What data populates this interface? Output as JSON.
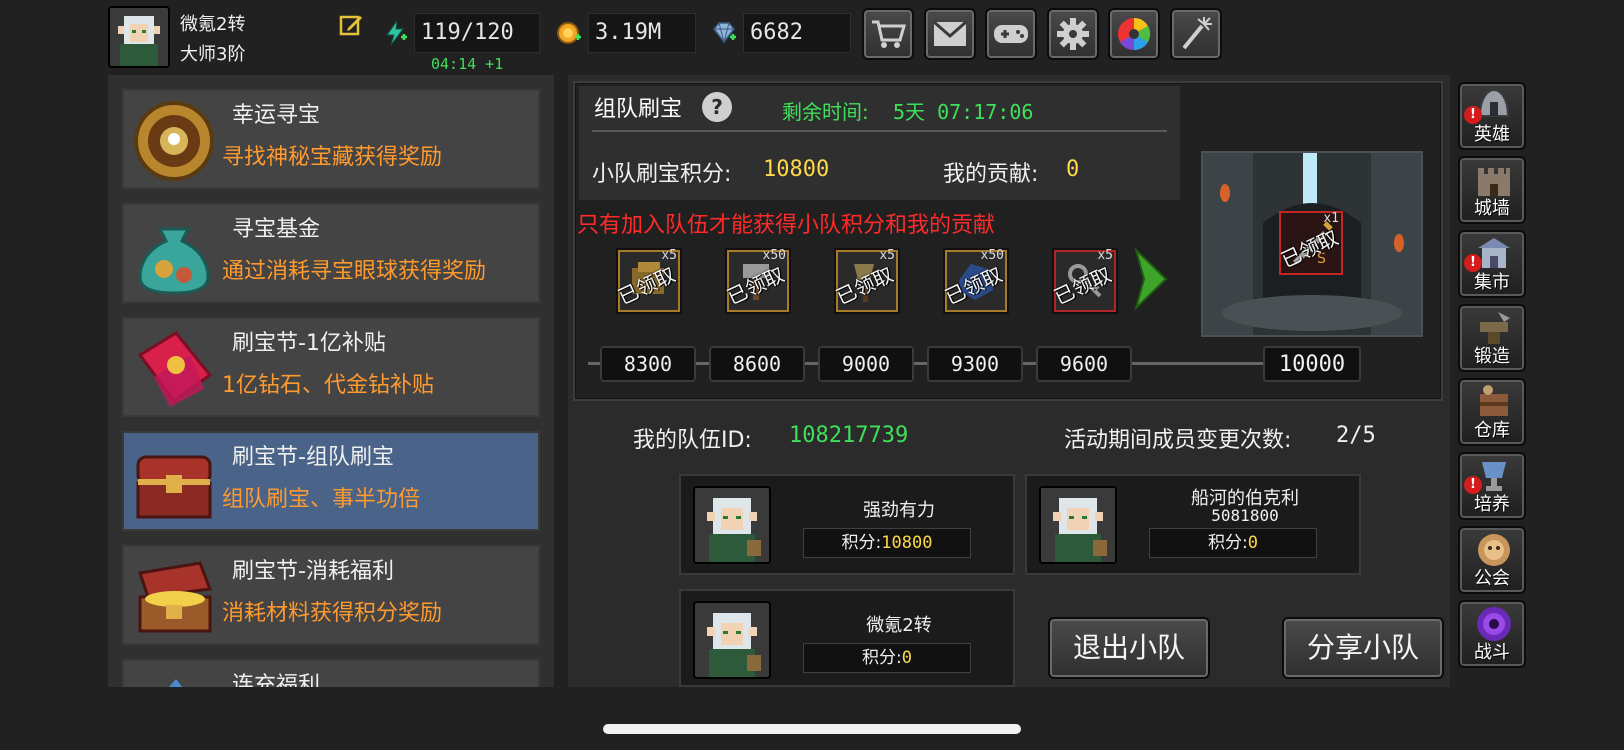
{
  "player": {
    "name": "微氪2转",
    "rank": "大师3阶"
  },
  "resources": {
    "stamina": "119/120",
    "stamina_timer": "04:14 +1",
    "gold": "3.19M",
    "diamonds": "6682"
  },
  "top_buttons": [
    "shop-cart-icon",
    "mail-icon",
    "gamepad-icon",
    "gear-icon",
    "color-wheel-icon",
    "fireworks-icon"
  ],
  "events": [
    {
      "title": "幸运寻宝",
      "desc": "寻找神秘宝藏获得奖励"
    },
    {
      "title": "寻宝基金",
      "desc": "通过消耗寻宝眼球获得奖励"
    },
    {
      "title": "刷宝节-1亿补贴",
      "desc": "1亿钻石、代金钻补贴"
    },
    {
      "title": "刷宝节-组队刷宝",
      "desc": "组队刷宝、事半功倍"
    },
    {
      "title": "刷宝节-消耗福利",
      "desc": "消耗材料获得积分奖励"
    },
    {
      "title": "连充福利",
      "desc": ""
    }
  ],
  "team_hunt": {
    "title": "组队刷宝",
    "remaining_label": "剩余时间:",
    "remaining_value": "5天 07:17:06",
    "team_score_label": "小队刷宝积分:",
    "team_score": "10800",
    "my_contrib_label": "我的贡献:",
    "my_contrib": "0",
    "warning": "只有加入队伍才能获得小队积分和我的贡献",
    "claimed_stamp": "已领取",
    "rewards": [
      {
        "mult": "x5",
        "milestone": "8300"
      },
      {
        "mult": "x50",
        "milestone": "8600"
      },
      {
        "mult": "x5",
        "milestone": "9000"
      },
      {
        "mult": "x50",
        "milestone": "9300"
      },
      {
        "mult": "x5",
        "milestone": "9600"
      }
    ],
    "final_reward": {
      "mult": "x1",
      "milestone": "10000"
    }
  },
  "team": {
    "id_label": "我的队伍ID:",
    "id_value": "108217739",
    "changes_label": "活动期间成员变更次数:",
    "changes_value": "2/5",
    "score_label": "积分:",
    "members": [
      {
        "name": "强劲有力",
        "sub": "",
        "score": "10800"
      },
      {
        "name": "船河的伯克利",
        "sub": "5081800",
        "score": "0"
      },
      {
        "name": "微氪2转",
        "sub": "",
        "score": "0"
      }
    ],
    "leave_button": "退出小队",
    "share_button": "分享小队"
  },
  "nav": [
    {
      "label": "英雄",
      "alert": true
    },
    {
      "label": "城墙",
      "alert": false
    },
    {
      "label": "集市",
      "alert": true
    },
    {
      "label": "锻造",
      "alert": false
    },
    {
      "label": "仓库",
      "alert": false
    },
    {
      "label": "培养",
      "alert": true
    },
    {
      "label": "公会",
      "alert": false
    },
    {
      "label": "战斗",
      "alert": false
    }
  ],
  "colors": {
    "accent_green": "#3ee05a",
    "accent_orange": "#ff9a2e",
    "accent_yellow": "#ffd84a",
    "warning_red": "#ff2a2a",
    "selected_blue": "#4a6388"
  }
}
